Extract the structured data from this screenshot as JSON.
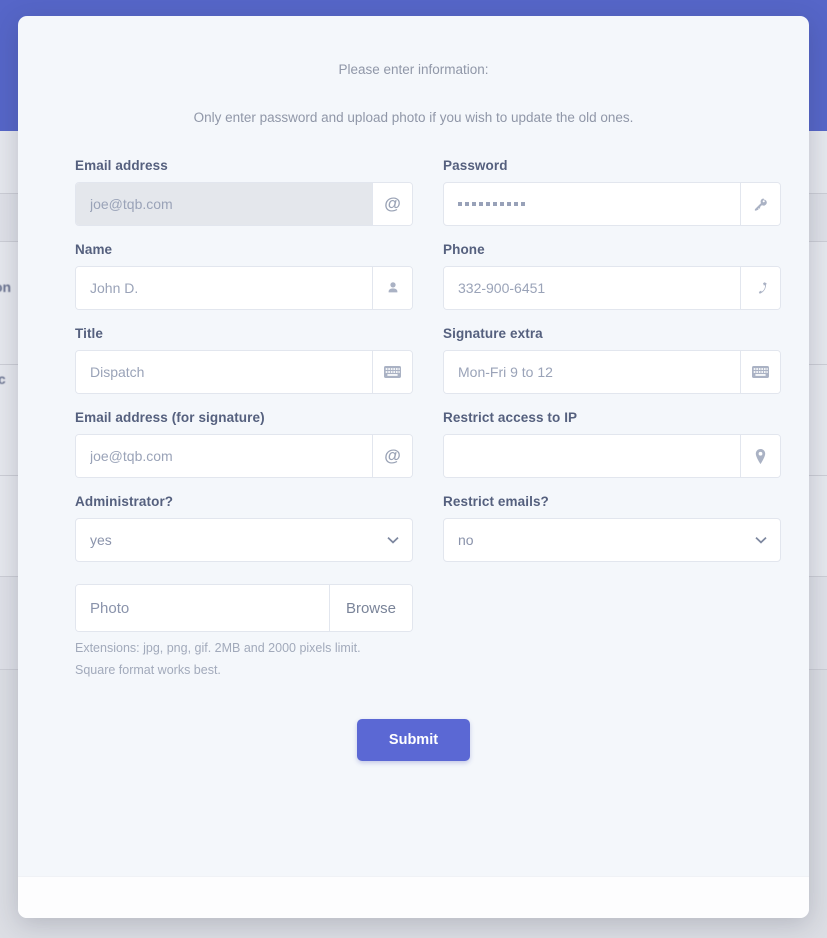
{
  "modal": {
    "intro_line1": "Please enter information:",
    "intro_line2": "Only enter password and upload photo if you wish to update the old ones.",
    "fields": {
      "email": {
        "label": "Email address",
        "placeholder": "joe@tqb.com",
        "value": "",
        "icon": "at-icon"
      },
      "password": {
        "label": "Password",
        "masked_value": "••••••••••",
        "dot_count": 10,
        "icon": "key-icon"
      },
      "name": {
        "label": "Name",
        "placeholder": "John D.",
        "value": "",
        "icon": "user-icon"
      },
      "phone": {
        "label": "Phone",
        "placeholder": "332-900-6451",
        "value": "",
        "icon": "phone-icon"
      },
      "title": {
        "label": "Title",
        "placeholder": "Dispatch",
        "value": "",
        "icon": "keyboard-icon"
      },
      "signature_extra": {
        "label": "Signature extra",
        "placeholder": "Mon-Fri 9 to 12",
        "value": "",
        "icon": "keyboard-icon"
      },
      "email_signature": {
        "label": "Email address (for signature)",
        "placeholder": "joe@tqb.com",
        "value": "",
        "icon": "at-icon"
      },
      "restrict_ip": {
        "label": "Restrict access to IP",
        "placeholder": "",
        "value": "",
        "icon": "map-pin-icon"
      },
      "administrator": {
        "label": "Administrator?",
        "value": "yes",
        "options": [
          "yes",
          "no"
        ],
        "icon": "chevron-down-icon"
      },
      "restrict_emails": {
        "label": "Restrict emails?",
        "value": "no",
        "options": [
          "yes",
          "no"
        ],
        "icon": "chevron-down-icon"
      },
      "photo": {
        "placeholder": "Photo",
        "value": "",
        "browse_label": "Browse",
        "hint_line1": "Extensions: jpg, png, gif. 2MB and 2000 pixels limit.",
        "hint_line2": "Square format works best."
      }
    },
    "submit_label": "Submit"
  },
  "backdrop": {
    "fragment_1": "on",
    "fragment_2": ".c"
  },
  "colors": {
    "accent": "#5b68d4",
    "topbar": "#5666c8",
    "modal_bg": "#f4f7fb",
    "label": "#55607e",
    "muted": "#9097a8"
  }
}
